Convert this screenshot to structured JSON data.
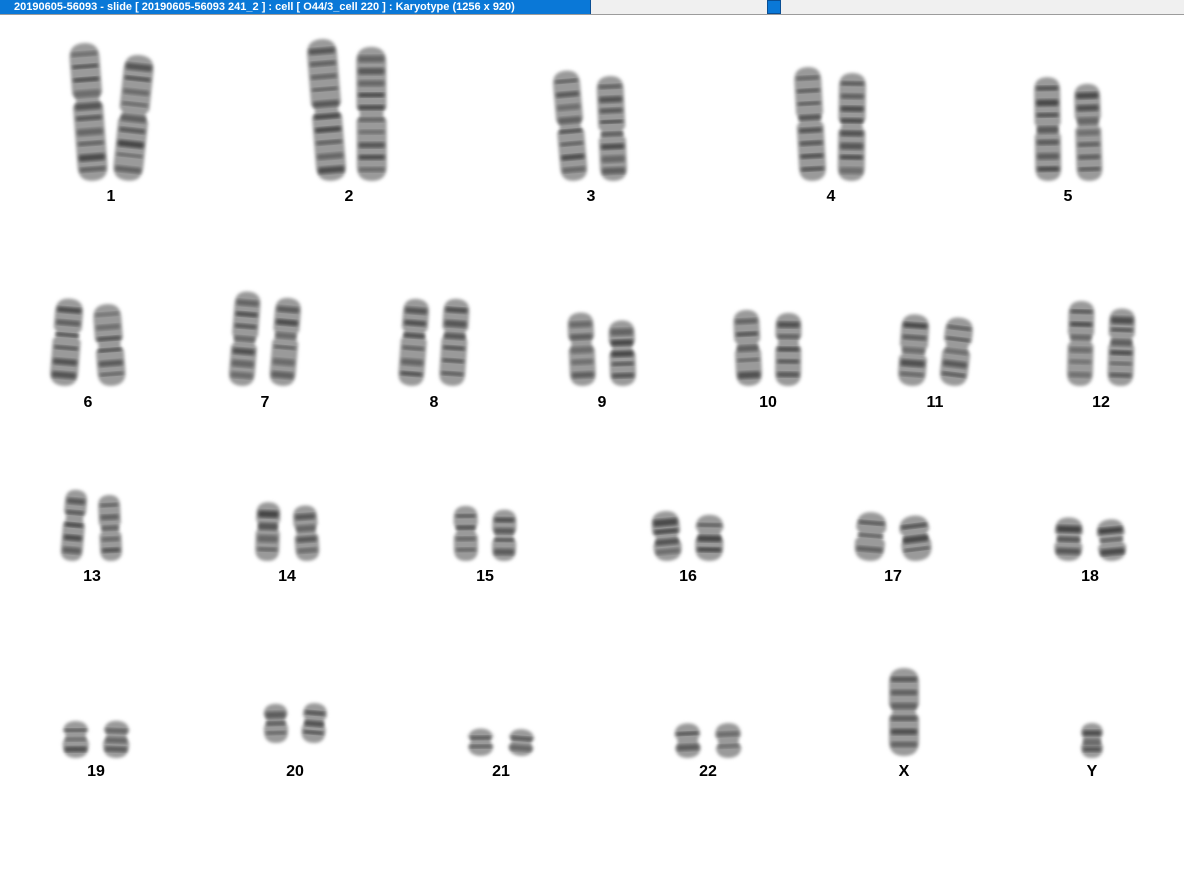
{
  "window": {
    "title": "20190605-56093 - slide [ 20190605-56093 241_2 ] : cell [ O44/3_cell 220 ] : Karyotype  (1256 x 920)"
  },
  "karyotype": {
    "rows": [
      {
        "chromosomes": [
          {
            "label": "1",
            "count": 2
          },
          {
            "label": "2",
            "count": 2
          },
          {
            "label": "3",
            "count": 2
          },
          {
            "label": "4",
            "count": 2
          },
          {
            "label": "5",
            "count": 2
          }
        ]
      },
      {
        "chromosomes": [
          {
            "label": "6",
            "count": 2
          },
          {
            "label": "7",
            "count": 2
          },
          {
            "label": "8",
            "count": 2
          },
          {
            "label": "9",
            "count": 2
          },
          {
            "label": "10",
            "count": 2
          },
          {
            "label": "11",
            "count": 2
          },
          {
            "label": "12",
            "count": 2
          }
        ]
      },
      {
        "chromosomes": [
          {
            "label": "13",
            "count": 2
          },
          {
            "label": "14",
            "count": 2
          },
          {
            "label": "15",
            "count": 2
          },
          {
            "label": "16",
            "count": 2
          },
          {
            "label": "17",
            "count": 2
          },
          {
            "label": "18",
            "count": 2
          }
        ]
      },
      {
        "chromosomes": [
          {
            "label": "19",
            "count": 2
          },
          {
            "label": "20",
            "count": 2
          },
          {
            "label": "21",
            "count": 2
          },
          {
            "label": "22",
            "count": 2
          },
          {
            "label": "X",
            "count": 1
          },
          {
            "label": "Y",
            "count": 1
          }
        ]
      }
    ]
  },
  "colors": {
    "title_bar": "#0a78d7",
    "chromosome_dark": "#3a3a3a",
    "chromosome_light": "#9a9a9a",
    "background": "#ffffff"
  }
}
